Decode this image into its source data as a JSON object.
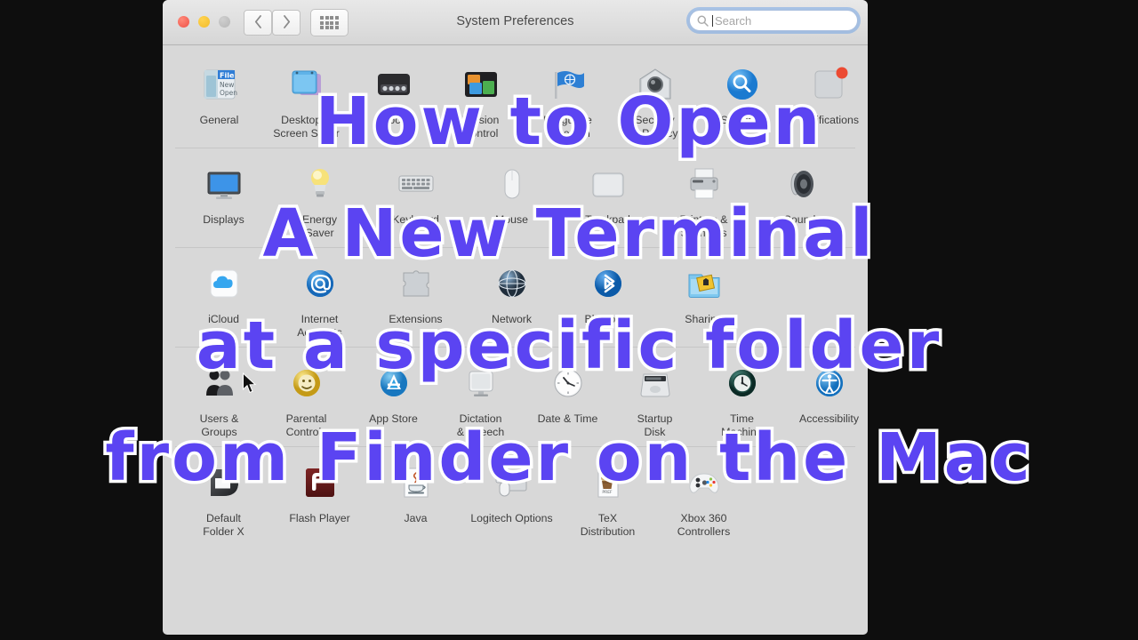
{
  "window": {
    "title": "System Preferences",
    "controls": {
      "close": "close-button",
      "minimize": "minimize-button",
      "zoom": "zoom-button"
    },
    "toolbar": {
      "back": "‹",
      "forward": "›",
      "show_all": "Show All"
    },
    "search": {
      "placeholder": "Search",
      "value": ""
    }
  },
  "rows": [
    {
      "separator": true,
      "items": [
        {
          "label": "General",
          "icon": "general-icon"
        },
        {
          "label": "Desktop &\nScreen Saver",
          "icon": "desktop-screen-saver-icon"
        },
        {
          "label": "Dock",
          "icon": "dock-icon"
        },
        {
          "label": "Mission\nControl",
          "icon": "mission-control-icon"
        },
        {
          "label": "Language\n& Region",
          "icon": "language-region-icon"
        },
        {
          "label": "Security\n& Privacy",
          "icon": "security-privacy-icon"
        },
        {
          "label": "Spotlight",
          "icon": "spotlight-icon"
        },
        {
          "label": "Notifications",
          "icon": "notifications-icon"
        }
      ]
    },
    {
      "separator": true,
      "items": [
        {
          "label": "Displays",
          "icon": "displays-icon"
        },
        {
          "label": "Energy\nSaver",
          "icon": "energy-saver-icon"
        },
        {
          "label": "Keyboard",
          "icon": "keyboard-icon"
        },
        {
          "label": "Mouse",
          "icon": "mouse-icon"
        },
        {
          "label": "Trackpad",
          "icon": "trackpad-icon"
        },
        {
          "label": "Printers &\nScanners",
          "icon": "printers-scanners-icon"
        },
        {
          "label": "Sound",
          "icon": "sound-icon"
        }
      ]
    },
    {
      "separator": true,
      "items": [
        {
          "label": "iCloud",
          "icon": "icloud-icon"
        },
        {
          "label": "Internet\nAccounts",
          "icon": "internet-accounts-icon"
        },
        {
          "label": "Extensions",
          "icon": "extensions-icon"
        },
        {
          "label": "Network",
          "icon": "network-icon"
        },
        {
          "label": "Bluetooth",
          "icon": "bluetooth-icon"
        },
        {
          "label": "Sharing",
          "icon": "sharing-icon"
        }
      ]
    },
    {
      "separator": true,
      "items": [
        {
          "label": "Users &\nGroups",
          "icon": "users-groups-icon"
        },
        {
          "label": "Parental\nControls",
          "icon": "parental-controls-icon"
        },
        {
          "label": "App Store",
          "icon": "app-store-icon"
        },
        {
          "label": "Dictation\n& Speech",
          "icon": "dictation-speech-icon"
        },
        {
          "label": "Date & Time",
          "icon": "date-time-icon"
        },
        {
          "label": "Startup\nDisk",
          "icon": "startup-disk-icon"
        },
        {
          "label": "Time\nMachine",
          "icon": "time-machine-icon"
        },
        {
          "label": "Accessibility",
          "icon": "accessibility-icon"
        }
      ]
    },
    {
      "separator": false,
      "items": [
        {
          "label": "Default\nFolder X",
          "icon": "default-folder-x-icon"
        },
        {
          "label": "Flash Player",
          "icon": "flash-player-icon"
        },
        {
          "label": "Java",
          "icon": "java-icon"
        },
        {
          "label": "Logitech Options",
          "icon": "logitech-options-icon"
        },
        {
          "label": "TeX\nDistribution",
          "icon": "tex-distribution-icon"
        },
        {
          "label": "Xbox 360\nControllers",
          "icon": "xbox-360-controllers-icon"
        }
      ]
    }
  ],
  "overlay": {
    "line1": "How to Open",
    "line2": "A New Terminal",
    "line3": "at a specific folder",
    "line4": "from Finder on the Mac",
    "text_color": "#5b44f2",
    "stroke_color": "#ffffff"
  },
  "background_color": "#0e0e0e"
}
